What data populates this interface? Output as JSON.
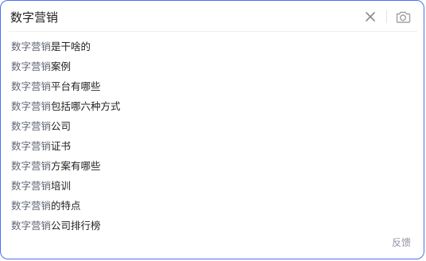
{
  "search": {
    "value": "数字营销",
    "placeholder": ""
  },
  "icons": {
    "clear": "close-icon",
    "camera": "camera-icon"
  },
  "suggestions": [
    {
      "query": "数字营销",
      "rest": "是干啥的"
    },
    {
      "query": "数字营销",
      "rest": "案例"
    },
    {
      "query": "数字营销",
      "rest": "平台有哪些"
    },
    {
      "query": "数字营销",
      "rest": "包括哪六种方式"
    },
    {
      "query": "数字营销",
      "rest": "公司"
    },
    {
      "query": "数字营销",
      "rest": "证书"
    },
    {
      "query": "数字营销",
      "rest": "方案有哪些"
    },
    {
      "query": "数字营销",
      "rest": "培训"
    },
    {
      "query": "数字营销",
      "rest": "的特点"
    },
    {
      "query": "数字营销",
      "rest": "公司排行榜"
    }
  ],
  "footer": {
    "feedback_label": "反馈"
  },
  "colors": {
    "accent_border": "#4e6ef2",
    "query_text": "#626675",
    "suggestion_text": "#222222",
    "feedback_text": "#9195a3"
  }
}
